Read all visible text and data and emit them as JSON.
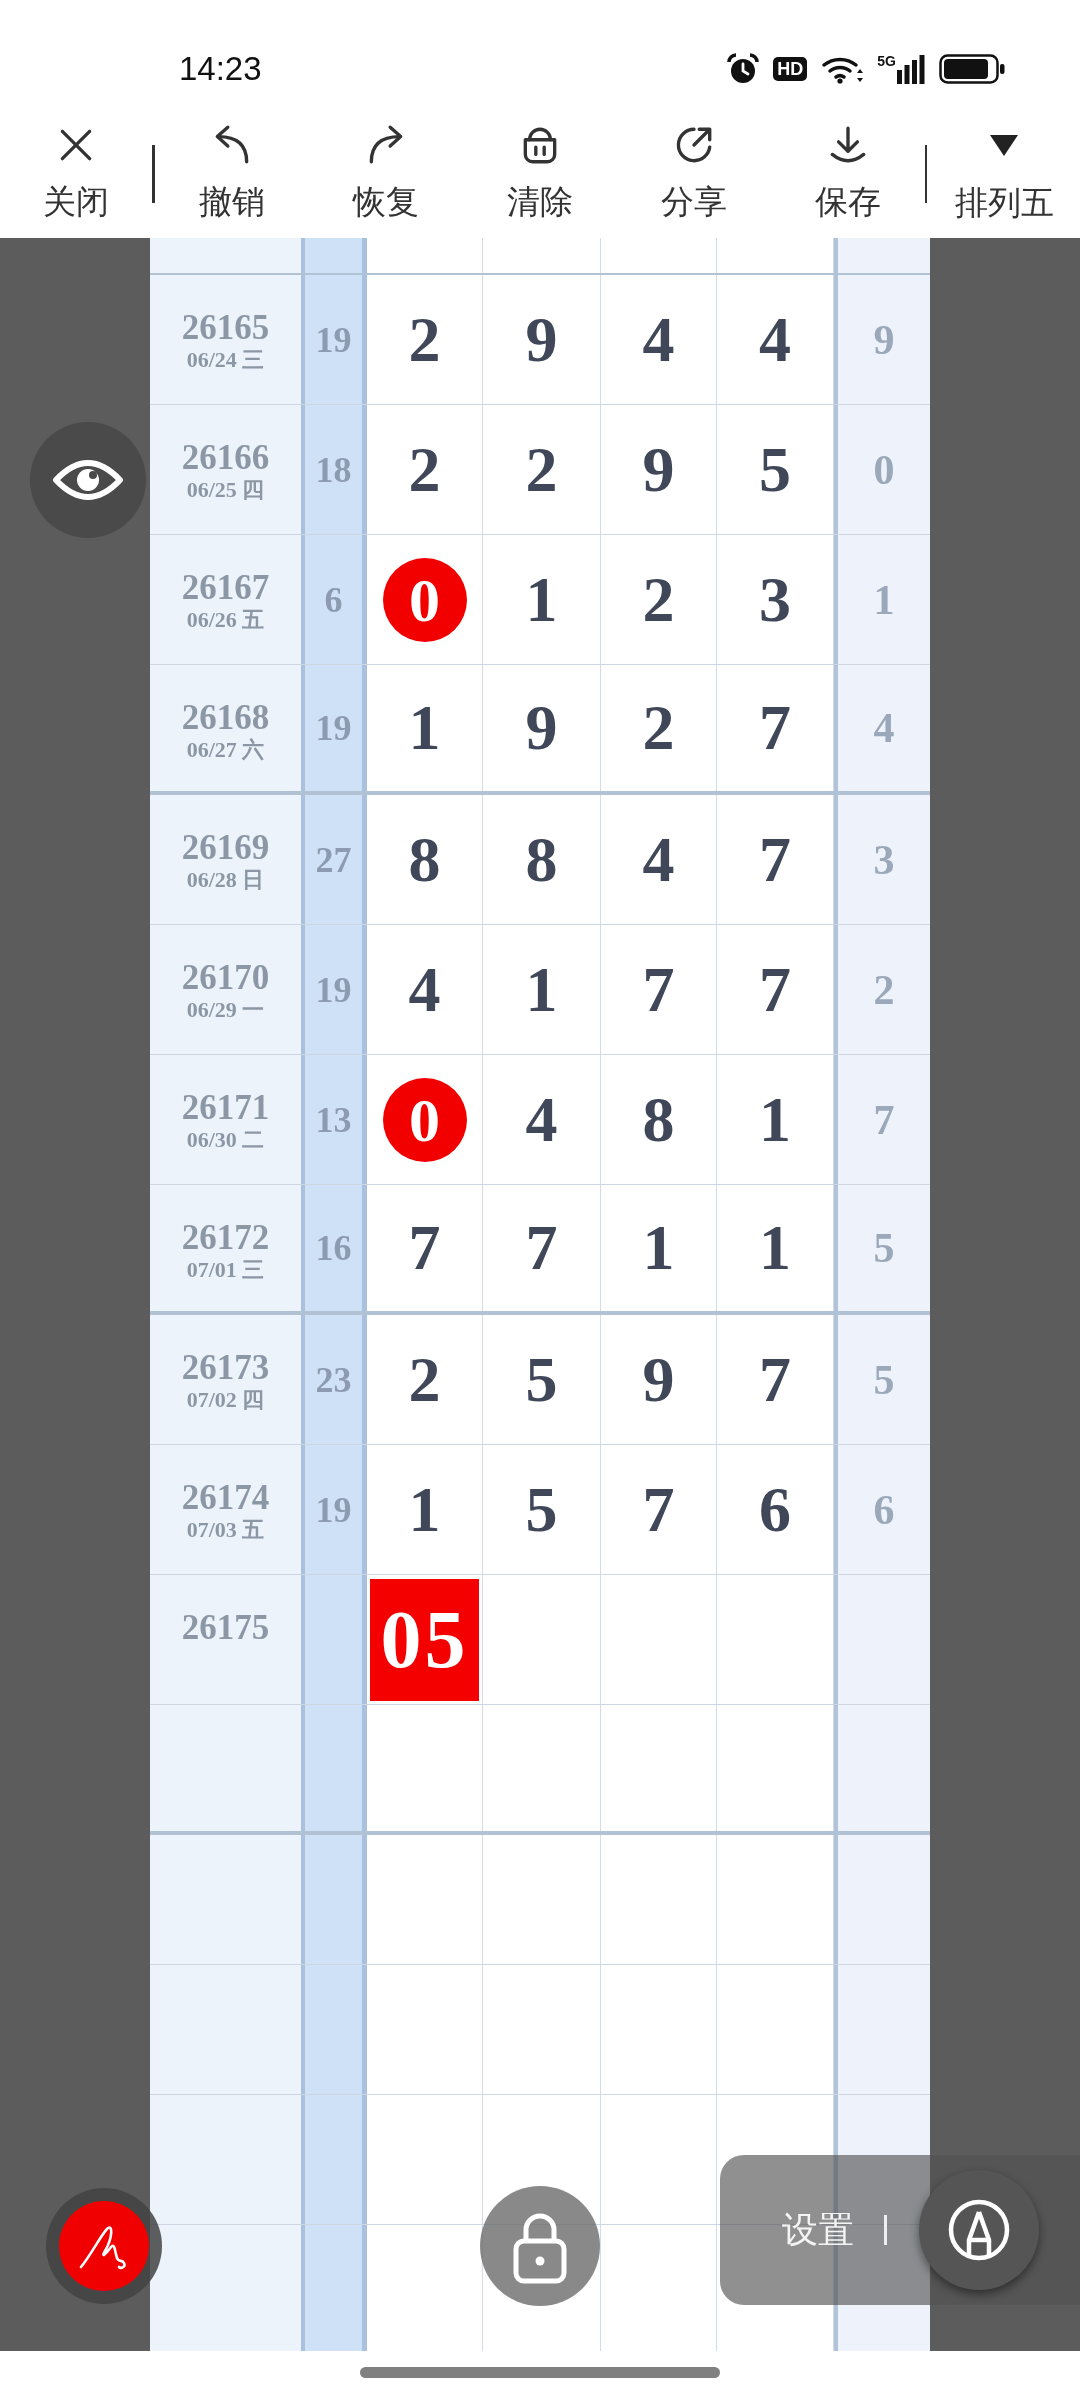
{
  "status_bar": {
    "time": "14:23",
    "hd_badge": "HD",
    "network": "5G"
  },
  "toolbar": {
    "close": {
      "label": "关闭"
    },
    "actions": [
      {
        "kind": "undo",
        "label": "撤销"
      },
      {
        "kind": "redo",
        "label": "恢复"
      },
      {
        "kind": "clear",
        "label": "清除"
      },
      {
        "kind": "share",
        "label": "分享"
      },
      {
        "kind": "save",
        "label": "保存"
      }
    ],
    "lottery_selector": {
      "label": "排列五"
    }
  },
  "chart": {
    "rows": [
      {
        "issue": "26165",
        "date": "06/24 三",
        "sum": "19",
        "digits": [
          {
            "value": "2",
            "circled": false
          },
          {
            "value": "9",
            "circled": false
          },
          {
            "value": "4",
            "circled": false
          },
          {
            "value": "4",
            "circled": false
          }
        ],
        "column_7": "9"
      },
      {
        "issue": "26166",
        "date": "06/25 四",
        "sum": "18",
        "digits": [
          {
            "value": "2",
            "circled": false
          },
          {
            "value": "2",
            "circled": false
          },
          {
            "value": "9",
            "circled": false
          },
          {
            "value": "5",
            "circled": false
          }
        ],
        "column_7": "0"
      },
      {
        "issue": "26167",
        "date": "06/26 五",
        "sum": "6",
        "digits": [
          {
            "value": "0",
            "circled": true
          },
          {
            "value": "1",
            "circled": false
          },
          {
            "value": "2",
            "circled": false
          },
          {
            "value": "3",
            "circled": false
          }
        ],
        "column_7": "1"
      },
      {
        "issue": "26168",
        "date": "06/27 六",
        "sum": "19",
        "digits": [
          {
            "value": "1",
            "circled": false
          },
          {
            "value": "9",
            "circled": false
          },
          {
            "value": "2",
            "circled": false
          },
          {
            "value": "7",
            "circled": false
          }
        ],
        "column_7": "4"
      },
      {
        "issue": "26169",
        "date": "06/28 日",
        "sum": "27",
        "digits": [
          {
            "value": "8",
            "circled": false
          },
          {
            "value": "8",
            "circled": false
          },
          {
            "value": "4",
            "circled": false
          },
          {
            "value": "7",
            "circled": false
          }
        ],
        "column_7": "3"
      },
      {
        "issue": "26170",
        "date": "06/29 一",
        "sum": "19",
        "digits": [
          {
            "value": "4",
            "circled": false
          },
          {
            "value": "1",
            "circled": false
          },
          {
            "value": "7",
            "circled": false
          },
          {
            "value": "7",
            "circled": false
          }
        ],
        "column_7": "2"
      },
      {
        "issue": "26171",
        "date": "06/30 二",
        "sum": "13",
        "digits": [
          {
            "value": "0",
            "circled": true
          },
          {
            "value": "4",
            "circled": false
          },
          {
            "value": "8",
            "circled": false
          },
          {
            "value": "1",
            "circled": false
          }
        ],
        "column_7": "7"
      },
      {
        "issue": "26172",
        "date": "07/01 三",
        "sum": "16",
        "digits": [
          {
            "value": "7",
            "circled": false
          },
          {
            "value": "7",
            "circled": false
          },
          {
            "value": "1",
            "circled": false
          },
          {
            "value": "1",
            "circled": false
          }
        ],
        "column_7": "5"
      },
      {
        "issue": "26173",
        "date": "07/02 四",
        "sum": "23",
        "digits": [
          {
            "value": "2",
            "circled": false
          },
          {
            "value": "5",
            "circled": false
          },
          {
            "value": "9",
            "circled": false
          },
          {
            "value": "7",
            "circled": false
          }
        ],
        "column_7": "5"
      },
      {
        "issue": "26174",
        "date": "07/03 五",
        "sum": "19",
        "digits": [
          {
            "value": "1",
            "circled": false
          },
          {
            "value": "5",
            "circled": false
          },
          {
            "value": "7",
            "circled": false
          },
          {
            "value": "6",
            "circled": false
          }
        ],
        "column_7": "6"
      },
      {
        "issue": "26175",
        "marker": "05"
      }
    ]
  },
  "controls": {
    "pen_button": {
      "active": true
    },
    "settings_label": "设置"
  }
}
